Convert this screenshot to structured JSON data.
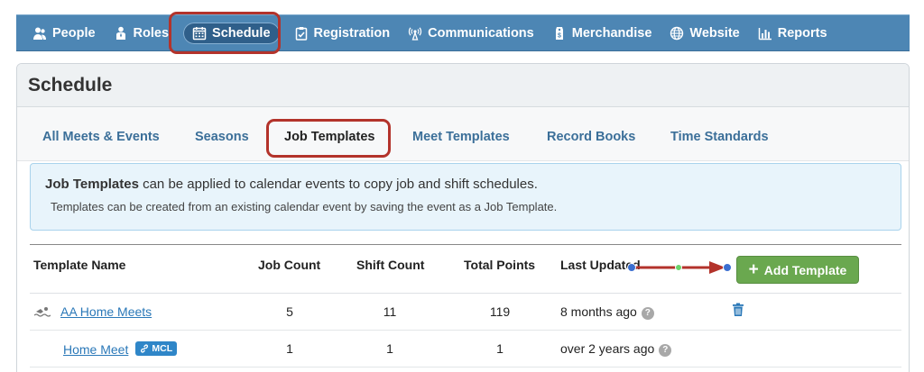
{
  "nav": {
    "items": [
      {
        "label": "People",
        "icon": "people-icon"
      },
      {
        "label": "Roles",
        "icon": "roles-icon"
      },
      {
        "label": "Schedule",
        "icon": "calendar-icon",
        "active": true
      },
      {
        "label": "Registration",
        "icon": "clipboard-icon"
      },
      {
        "label": "Communications",
        "icon": "broadcast-icon"
      },
      {
        "label": "Merchandise",
        "icon": "price-tag-icon"
      },
      {
        "label": "Website",
        "icon": "globe-icon"
      },
      {
        "label": "Reports",
        "icon": "bar-chart-icon"
      }
    ]
  },
  "page": {
    "title": "Schedule"
  },
  "tabs": [
    {
      "label": "All Meets & Events"
    },
    {
      "label": "Seasons"
    },
    {
      "label": "Job Templates",
      "active": true
    },
    {
      "label": "Meet Templates"
    },
    {
      "label": "Record Books"
    },
    {
      "label": "Time Standards"
    }
  ],
  "info": {
    "bold": "Job Templates",
    "line1_rest": " can be applied to calendar events to copy job and shift schedules.",
    "line2": "Templates can be created from an existing calendar event by saving the event as a Job Template."
  },
  "table": {
    "headers": {
      "name": "Template Name",
      "job_count": "Job Count",
      "shift_count": "Shift Count",
      "total_points": "Total Points",
      "last_updated": "Last Updated"
    },
    "add_button": "Add Template",
    "rows": [
      {
        "name": "AA Home Meets",
        "job_count": "5",
        "shift_count": "11",
        "total_points": "119",
        "last_updated": "8 months ago",
        "icon": "swimmer-icon",
        "deletable": true
      },
      {
        "name": "Home Meet",
        "badge": "MCL",
        "job_count": "1",
        "shift_count": "1",
        "total_points": "1",
        "last_updated": "over 2 years ago"
      }
    ]
  },
  "colors": {
    "nav_bg": "#4d86b4",
    "highlight": "#b3332b",
    "add_button": "#6aa84f",
    "link": "#2a78b8",
    "info_bg": "#e8f4fb"
  }
}
